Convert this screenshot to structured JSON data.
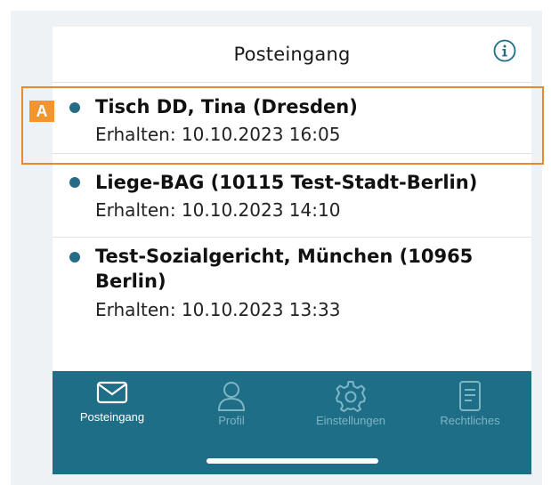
{
  "header": {
    "title": "Posteingang",
    "info_icon": "info-icon"
  },
  "inbox": {
    "items": [
      {
        "title": "Tisch DD, Tina (Dresden)",
        "received": "Erhalten: 10.10.2023 16:05",
        "unread": true
      },
      {
        "title": "Liege-BAG (10115 Test-Stadt-Berlin)",
        "received": "Erhalten: 10.10.2023 14:10",
        "unread": true
      },
      {
        "title_line1": "Test-Sozialgericht, München (10965",
        "title_line2": "Berlin)",
        "received": "Erhalten: 10.10.2023 13:33",
        "unread": true
      }
    ]
  },
  "tabbar": {
    "tabs": [
      {
        "label": "Posteingang",
        "icon": "envelope-icon",
        "active": true
      },
      {
        "label": "Profil",
        "icon": "user-icon",
        "active": false
      },
      {
        "label": "Einstellungen",
        "icon": "gear-icon",
        "active": false
      },
      {
        "label": "Rechtliches",
        "icon": "document-icon",
        "active": false
      }
    ]
  },
  "annotation": {
    "marker": "A"
  },
  "colors": {
    "accent": "#1d6e86",
    "unread_dot": "#276c86",
    "highlight": "#e8892c"
  }
}
